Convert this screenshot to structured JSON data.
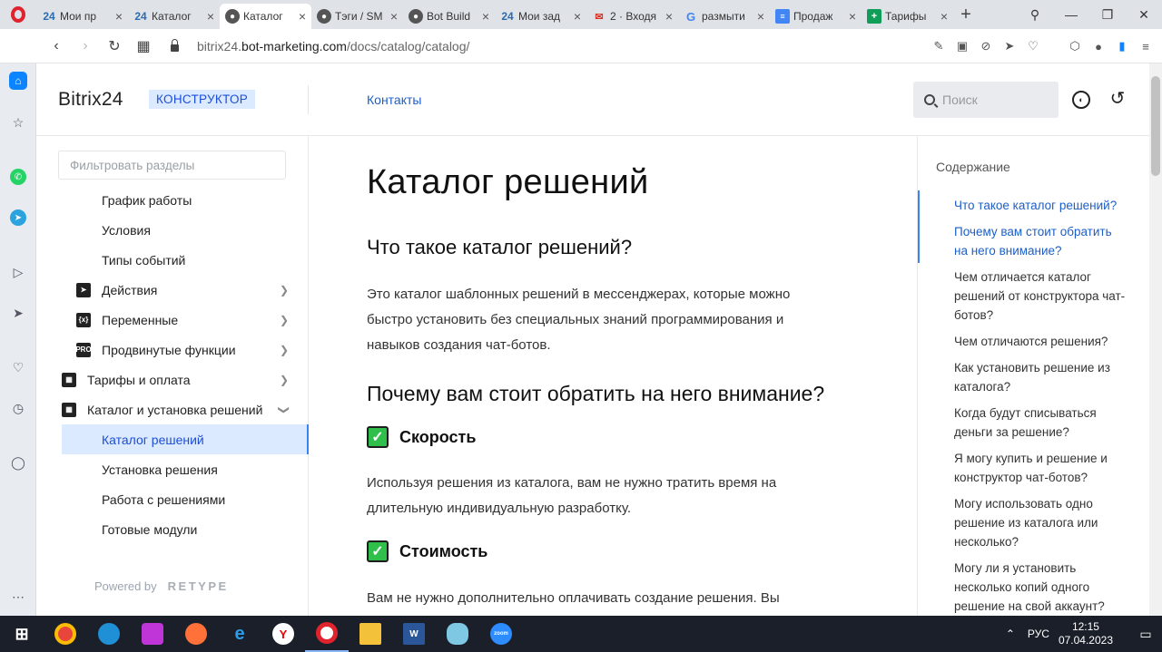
{
  "browser": {
    "tabs": [
      {
        "icon": "bitrix24-icon",
        "title": "Мои пр",
        "active": false
      },
      {
        "icon": "bitrix24-icon",
        "title": "Каталог",
        "active": false
      },
      {
        "icon": "globe-icon",
        "title": "Каталог",
        "active": true
      },
      {
        "icon": "globe-icon",
        "title": "Тэги / SM",
        "active": false
      },
      {
        "icon": "globe-icon",
        "title": "Bot Build",
        "active": false
      },
      {
        "icon": "bitrix24-icon",
        "title": "Мои зад",
        "active": false
      },
      {
        "icon": "mail-icon",
        "title": "2 · Входя",
        "active": false
      },
      {
        "icon": "google-icon",
        "title": "размыти",
        "active": false
      },
      {
        "icon": "docs-icon",
        "title": "Продаж",
        "active": false
      },
      {
        "icon": "sheets-icon",
        "title": "Тарифы",
        "active": false
      }
    ],
    "url_host": "bitrix24.",
    "url_domain": "bot-marketing.com",
    "url_path": "/docs/catalog/catalog/"
  },
  "header": {
    "brand": "Bitrix24",
    "badge": "КОНСТРУКТОР",
    "contacts_link": "Контакты",
    "search_placeholder": "Поиск"
  },
  "left_nav": {
    "filter_placeholder": "Фильтровать разделы",
    "items": [
      {
        "label": "График работы",
        "indent": 2,
        "icon": "",
        "chevron": false,
        "active": false
      },
      {
        "label": "Условия",
        "indent": 2,
        "icon": "",
        "chevron": false,
        "active": false
      },
      {
        "label": "Типы событий",
        "indent": 2,
        "icon": "",
        "chevron": false,
        "active": false
      },
      {
        "label": "Действия",
        "indent": 1,
        "icon": "action-icon",
        "chevron": "right",
        "active": false
      },
      {
        "label": "Переменные",
        "indent": 1,
        "icon": "variable-icon",
        "chevron": "right",
        "active": false
      },
      {
        "label": "Продвинутые функции",
        "indent": 1,
        "icon": "pro-icon",
        "chevron": "right",
        "active": false
      },
      {
        "label": "Тарифы и оплата",
        "indent": 0,
        "icon": "table-icon",
        "chevron": "right",
        "active": false
      },
      {
        "label": "Каталог и установка решений",
        "indent": 0,
        "icon": "grid-icon",
        "chevron": "down",
        "active": false
      },
      {
        "label": "Каталог решений",
        "indent": 2,
        "icon": "",
        "chevron": false,
        "active": true
      },
      {
        "label": "Установка решения",
        "indent": 2,
        "icon": "",
        "chevron": false,
        "active": false
      },
      {
        "label": "Работа с решениями",
        "indent": 2,
        "icon": "",
        "chevron": false,
        "active": false
      },
      {
        "label": "Готовые модули",
        "indent": 2,
        "icon": "",
        "chevron": false,
        "active": false
      }
    ],
    "powered_by": "Powered by",
    "retype": "RETYPE"
  },
  "content": {
    "title": "Каталог решений",
    "h2_1": "Что такое каталог решений?",
    "p1": "Это каталог шаблонных решений в мессенджерах, которые можно быстро установить без специальных знаний программирования и навыков создания чат-ботов.",
    "h2_2": "Почему вам стоит обратить на него внимание?",
    "h3_1": "Скорость",
    "p2": "Используя решения из каталога, вам не нужно тратить время на длительную индивидуальную разработку.",
    "h3_2": "Стоимость",
    "p3": "Вам не нужно дополнительно оплачивать создание решения. Вы"
  },
  "toc": {
    "title": "Содержание",
    "items": [
      "Что такое каталог решений?",
      "Почему вам стоит обратить на него внимание?",
      "Чем отличается каталог решений от конструктора чат-ботов?",
      "Чем отличаются решения?",
      "Как установить решение из каталога?",
      "Когда будут списываться деньги за решение?",
      "Я могу купить и решение и конструктор чат-ботов?",
      "Могу использовать одно решение из каталога или несколько?",
      "Могу ли я установить несколько копий одного решение на свой аккаунт?"
    ]
  },
  "taskbar": {
    "lang": "РУС",
    "time": "12:15",
    "date": "07.04.2023"
  }
}
